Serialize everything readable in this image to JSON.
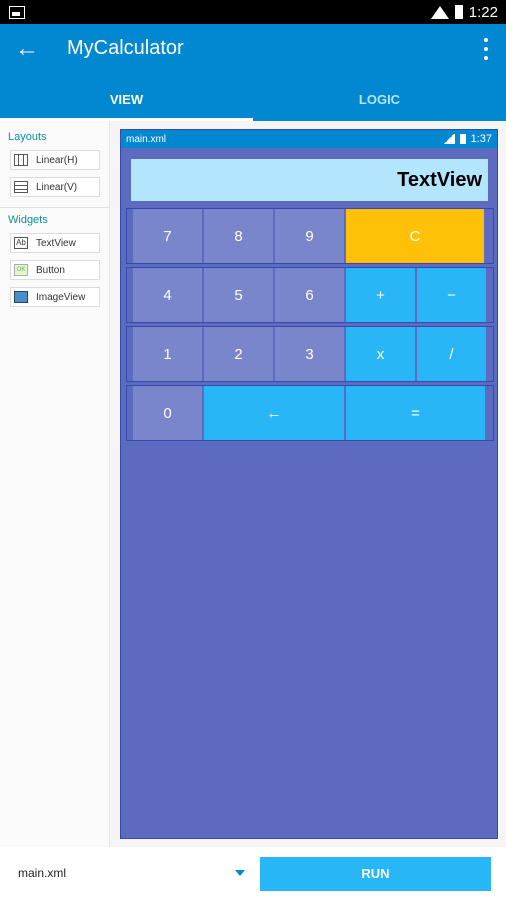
{
  "statusbar": {
    "time": "1:22"
  },
  "appbar": {
    "title": "MyCalculator",
    "back_icon": "back-arrow-icon",
    "menu_icon": "overflow-menu-icon"
  },
  "tabs": [
    {
      "label": "VIEW",
      "active": true
    },
    {
      "label": "LOGIC",
      "active": false
    }
  ],
  "sidebar": {
    "layouts_title": "Layouts",
    "layouts": [
      {
        "label": "Linear(H)"
      },
      {
        "label": "Linear(V)"
      }
    ],
    "widgets_title": "Widgets",
    "widgets": [
      {
        "label": "TextView"
      },
      {
        "label": "Button"
      },
      {
        "label": "ImageView"
      }
    ]
  },
  "preview": {
    "filename": "main.xml",
    "time": "1:37",
    "textview": "TextView",
    "keys": {
      "k7": "7",
      "k8": "8",
      "k9": "9",
      "clear": "C",
      "k4": "4",
      "k5": "5",
      "k6": "6",
      "plus": "+",
      "minus": "−",
      "k1": "1",
      "k2": "2",
      "k3": "3",
      "times": "x",
      "divide": "/",
      "k0": "0",
      "backspace": "←",
      "equals": "="
    },
    "colors": {
      "background": "#5c6bc0",
      "number_key": "#7986cb",
      "operator_key": "#29b6f6",
      "clear_key": "#ffc107",
      "textview": "#b3e5fc"
    }
  },
  "bottom": {
    "file": "main.xml",
    "run": "RUN"
  }
}
